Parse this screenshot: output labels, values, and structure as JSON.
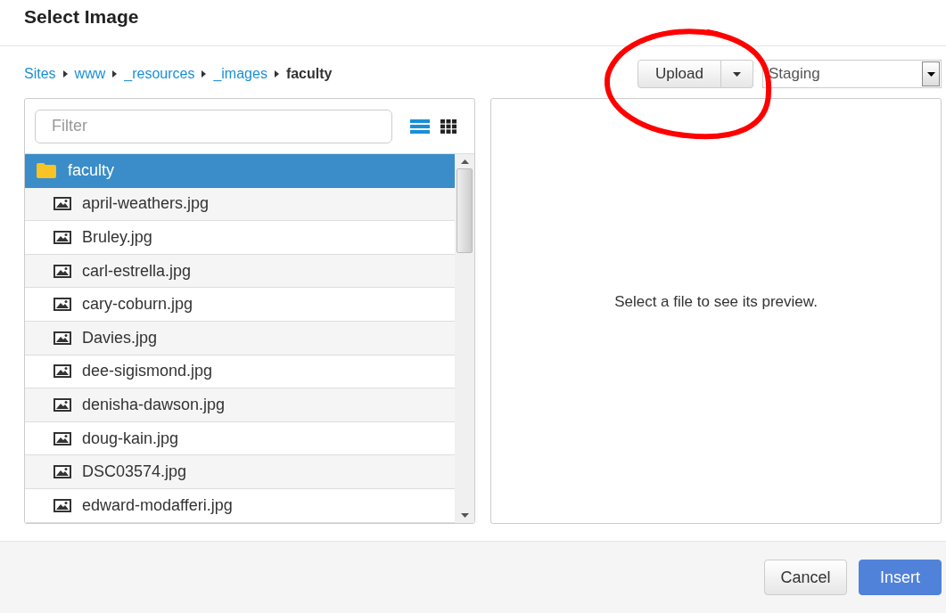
{
  "dialog": {
    "title": "Select Image"
  },
  "breadcrumb": [
    {
      "label": "Sites",
      "current": false
    },
    {
      "label": "www",
      "current": false
    },
    {
      "label": "_resources",
      "current": false
    },
    {
      "label": "_images",
      "current": false
    },
    {
      "label": "faculty",
      "current": true
    }
  ],
  "upload_button": {
    "label": "Upload"
  },
  "environment_select": {
    "value": "Staging"
  },
  "filter": {
    "placeholder": "Filter"
  },
  "view_modes": [
    {
      "kind": "list",
      "selected": true
    },
    {
      "kind": "grid",
      "selected": false
    }
  ],
  "files": [
    {
      "kind": "folder",
      "name": "faculty",
      "selected": true
    },
    {
      "kind": "image",
      "name": "april-weathers.jpg",
      "selected": false
    },
    {
      "kind": "image",
      "name": "Bruley.jpg",
      "selected": false
    },
    {
      "kind": "image",
      "name": "carl-estrella.jpg",
      "selected": false
    },
    {
      "kind": "image",
      "name": "cary-coburn.jpg",
      "selected": false
    },
    {
      "kind": "image",
      "name": "Davies.jpg",
      "selected": false
    },
    {
      "kind": "image",
      "name": "dee-sigismond.jpg",
      "selected": false
    },
    {
      "kind": "image",
      "name": "denisha-dawson.jpg",
      "selected": false
    },
    {
      "kind": "image",
      "name": "doug-kain.jpg",
      "selected": false
    },
    {
      "kind": "image",
      "name": "DSC03574.jpg",
      "selected": false
    },
    {
      "kind": "image",
      "name": "edward-modafferi.jpg",
      "selected": false
    }
  ],
  "preview": {
    "message": "Select a file to see its preview."
  },
  "buttons": [
    {
      "label": "Cancel",
      "kind": "secondary"
    },
    {
      "label": "Insert",
      "kind": "primary"
    }
  ]
}
